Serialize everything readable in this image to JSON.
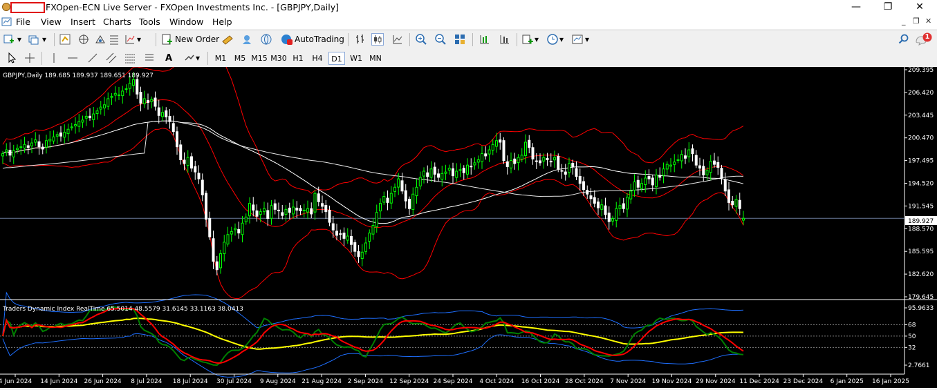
{
  "window": {
    "title": "FXOpen-ECN Live Server - FXOpen Investments Inc. - [GBPJPY,Daily]",
    "minimize_glyph": "—",
    "restore_glyph": "❐",
    "close_glyph": "✕"
  },
  "menu": {
    "items": [
      "File",
      "View",
      "Insert",
      "Charts",
      "Tools",
      "Window",
      "Help"
    ],
    "mdi_minimize": "_",
    "mdi_restore": "❐",
    "mdi_close": "✕"
  },
  "toolbar": {
    "new_order_label": "New Order",
    "autotrading_label": "AutoTrading",
    "notification_count": "1"
  },
  "timeframes": {
    "items": [
      "M1",
      "M5",
      "M15",
      "M30",
      "H1",
      "H4",
      "D1",
      "W1",
      "MN"
    ],
    "active": "D1"
  },
  "colors": {
    "chart_bg": "#000000",
    "bull_candle": "#00ff00",
    "bear_candle": "#ffffff",
    "bollinger": "#ff0000",
    "ma_slow": "#ffffff",
    "tdi_band": "#1e6fff",
    "tdi_rsi": "#008000",
    "tdi_signal": "#ff0000",
    "tdi_base": "#ffff00",
    "axis_text": "#ffffff"
  },
  "main_chart": {
    "header": "GBPJPY,Daily  189.685 189.937 189.651 189.927",
    "current_price": "189.927",
    "y_ticks": [
      "209.395",
      "206.420",
      "203.445",
      "200.470",
      "197.495",
      "194.520",
      "191.545",
      "188.570",
      "185.595",
      "182.620",
      "179.645"
    ]
  },
  "indicator": {
    "header": "Traders Dynamic Index RealTime 65.5014 48.5579 31.6145 33.1163 38.0413",
    "y_ticks": [
      "95.9633",
      "68",
      "50",
      "32",
      "2.7661"
    ]
  },
  "x_axis": {
    "labels": [
      "4 Jun 2024",
      "14 Jun 2024",
      "26 Jun 2024",
      "8 Jul 2024",
      "18 Jul 2024",
      "30 Jul 2024",
      "9 Aug 2024",
      "21 Aug 2024",
      "2 Sep 2024",
      "12 Sep 2024",
      "24 Sep 2024",
      "4 Oct 2024",
      "16 Oct 2024",
      "28 Oct 2024",
      "7 Nov 2024",
      "19 Nov 2024",
      "29 Nov 2024",
      "11 Dec 2024",
      "23 Dec 2024",
      "6 Jan 2025",
      "16 Jan 2025"
    ]
  },
  "chart_data": {
    "type": "candlestick",
    "symbol": "GBPJPY",
    "timeframe": "Daily",
    "last_ohlc": {
      "open": 189.685,
      "high": 189.937,
      "low": 189.651,
      "close": 189.927
    },
    "ylim": [
      179.645,
      209.395
    ],
    "closes": [
      198.4,
      198.9,
      198.2,
      198.8,
      199.1,
      199.3,
      199.6,
      199.2,
      199.8,
      200.2,
      199.3,
      199.0,
      200.1,
      200.3,
      200.6,
      200.9,
      200.7,
      201.2,
      201.6,
      201.9,
      202.2,
      202.6,
      202.8,
      203.3,
      203.1,
      203.6,
      204.0,
      204.5,
      204.8,
      205.6,
      205.9,
      206.3,
      206.1,
      206.6,
      206.9,
      207.6,
      208.1,
      206.2,
      205.0,
      205.6,
      205.1,
      205.5,
      204.6,
      203.4,
      203.8,
      203.2,
      202.6,
      201.3,
      199.3,
      197.6,
      197.1,
      197.9,
      196.5,
      196.0,
      195.1,
      193.0,
      189.8,
      187.5,
      184.3,
      183.2,
      185.3,
      186.8,
      187.8,
      188.2,
      188.6,
      188.0,
      189.3,
      190.1,
      191.9,
      191.0,
      190.2,
      190.8,
      191.2,
      189.9,
      191.6,
      191.1,
      190.9,
      190.3,
      191.1,
      190.7,
      191.4,
      191.0,
      190.9,
      191.0,
      191.2,
      190.5,
      193.2,
      192.1,
      191.5,
      190.8,
      189.4,
      188.4,
      187.7,
      187.9,
      187.3,
      187.6,
      186.5,
      185.6,
      184.9,
      185.5,
      186.7,
      188.0,
      189.0,
      190.7,
      191.9,
      192.8,
      192.0,
      193.2,
      194.0,
      195.1,
      193.5,
      192.2,
      191.2,
      193.1,
      194.0,
      195.3,
      196.1,
      195.4,
      196.4,
      195.7,
      195.3,
      195.8,
      196.0,
      196.5,
      195.5,
      196.1,
      196.3,
      195.9,
      196.9,
      196.7,
      197.2,
      197.6,
      198.4,
      198.1,
      198.9,
      199.6,
      200.1,
      199.9,
      197.5,
      196.7,
      197.5,
      197.1,
      197.9,
      198.2,
      199.9,
      199.2,
      197.7,
      197.4,
      197.2,
      197.9,
      197.6,
      197.4,
      197.9,
      196.4,
      196.1,
      195.7,
      197.1,
      196.7,
      195.4,
      194.5,
      193.7,
      193.1,
      192.5,
      191.9,
      191.3,
      191.7,
      190.4,
      189.5,
      189.9,
      191.2,
      191.6,
      191.2,
      192.7,
      193.5,
      194.7,
      194.0,
      194.5,
      195.2,
      195.1,
      194.3,
      195.6,
      195.3,
      196.4,
      197.0,
      196.9,
      197.3,
      197.6,
      198.3,
      197.8,
      198.9,
      198.4,
      196.9,
      196.5,
      195.6,
      196.2,
      197.4,
      197.0,
      196.6,
      195.2,
      193.5,
      192.0,
      191.7,
      192.4,
      191.2,
      189.927
    ]
  }
}
